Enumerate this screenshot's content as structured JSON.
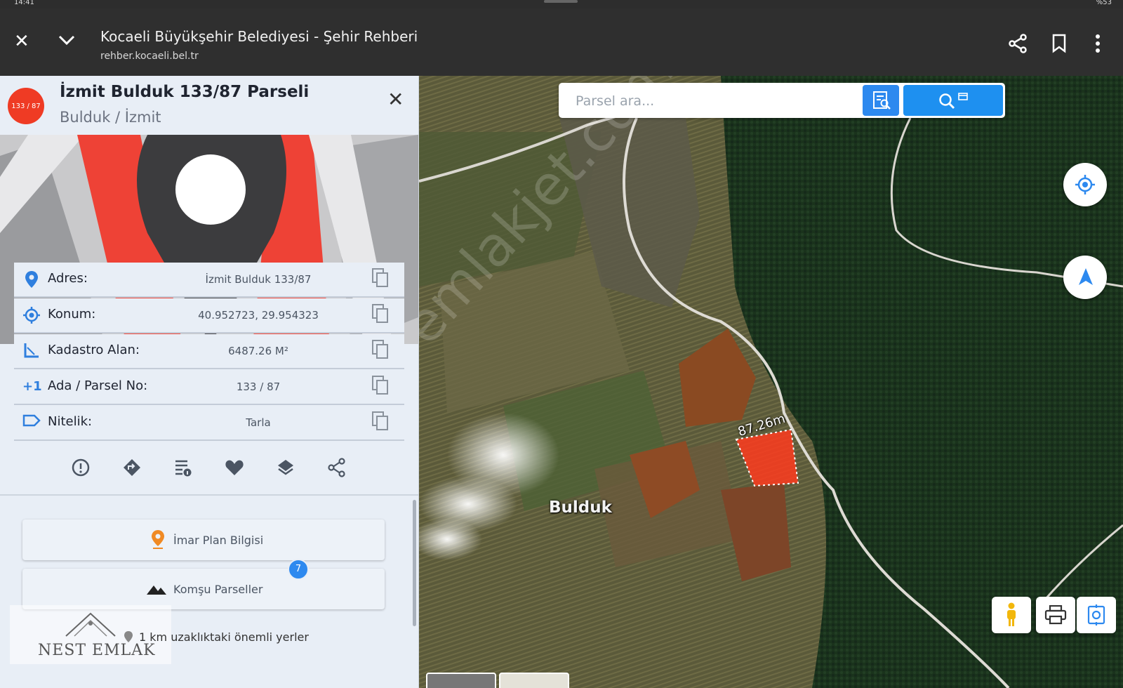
{
  "status_bar": {
    "time": "14:41",
    "battery": "%53"
  },
  "browser": {
    "page_title": "Kocaeli Büyükşehir Belediyesi - Şehir Rehberi",
    "url": "rehber.kocaeli.bel.tr"
  },
  "panel": {
    "badge": "133 / 87",
    "title": "İzmit Bulduk 133/87 Parseli",
    "subtitle": "Bulduk / İzmit",
    "rows": [
      {
        "label": "Adres:",
        "value": "İzmit Bulduk 133/87",
        "icon": "location-pin-icon"
      },
      {
        "label": "Konum:",
        "value": "40.952723, 29.954323",
        "icon": "crosshair-icon"
      },
      {
        "label": "Kadastro Alan:",
        "value": "6487.26 M²",
        "icon": "area-ruler-icon"
      },
      {
        "label": "Ada / Parsel No:",
        "value": "133 / 87",
        "icon": "plus-one-icon"
      },
      {
        "label": "Nitelik:",
        "value": "Tarla",
        "icon": "tag-icon"
      }
    ],
    "actions": [
      "report-icon",
      "directions-icon",
      "details-icon",
      "favorite-icon",
      "layers-icon",
      "share-icon"
    ],
    "buttons": {
      "zoning": "İmar Plan Bilgisi",
      "neighbors": "Komşu Parseller",
      "neighbors_count": "7"
    },
    "nearby": "1 km uzaklıktaki önemli yerler",
    "watermark": "NEST EMLAK"
  },
  "map": {
    "search_placeholder": "Parsel ara...",
    "village_label": "Bulduk",
    "measure_label": "87.26m",
    "watermark": "emlakjet.com",
    "parcel_color": "#ff3b1f"
  }
}
